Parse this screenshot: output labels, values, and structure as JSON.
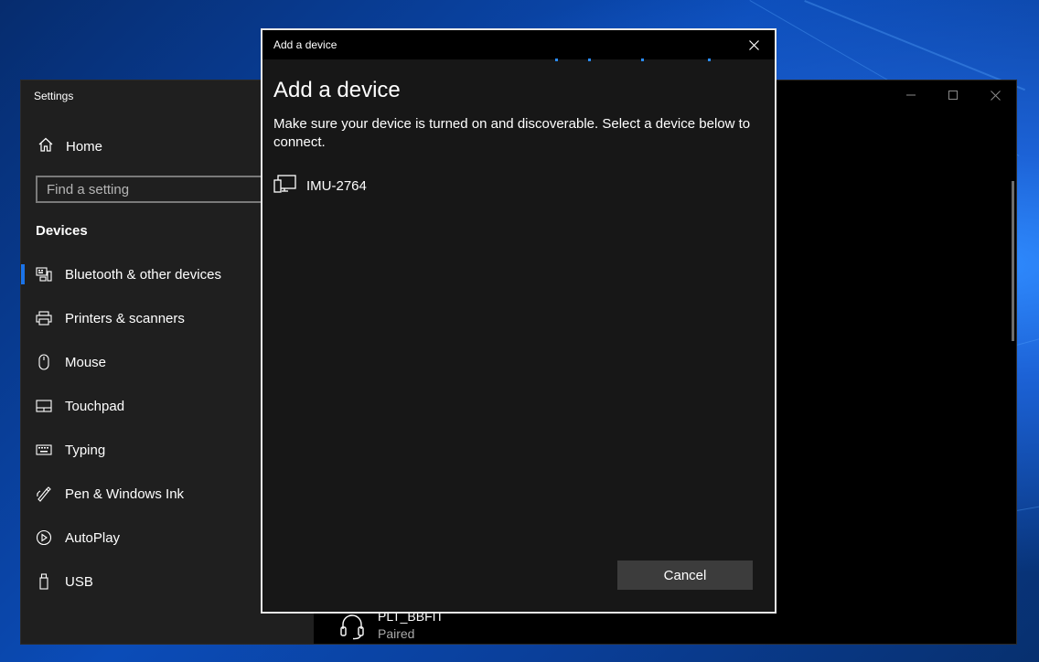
{
  "settings": {
    "title": "Settings",
    "home_label": "Home",
    "search_placeholder": "Find a setting",
    "section_title": "Devices",
    "nav_items": [
      {
        "label": "Bluetooth & other devices",
        "icon": "bluetooth-devices-icon",
        "selected": true
      },
      {
        "label": "Printers & scanners",
        "icon": "printer-icon",
        "selected": false
      },
      {
        "label": "Mouse",
        "icon": "mouse-icon",
        "selected": false
      },
      {
        "label": "Touchpad",
        "icon": "touchpad-icon",
        "selected": false
      },
      {
        "label": "Typing",
        "icon": "keyboard-icon",
        "selected": false
      },
      {
        "label": "Pen & Windows Ink",
        "icon": "pen-icon",
        "selected": false
      },
      {
        "label": "AutoPlay",
        "icon": "autoplay-icon",
        "selected": false
      },
      {
        "label": "USB",
        "icon": "usb-icon",
        "selected": false
      }
    ],
    "paired_device": {
      "name": "PLT_BBFIT",
      "status": "Paired",
      "icon": "headset-icon"
    }
  },
  "dialog": {
    "titlebar": "Add a device",
    "heading": "Add a device",
    "description": "Make sure your device is turned on and discoverable. Select a device below to connect.",
    "devices": [
      {
        "name": "IMU-2764",
        "icon": "generic-device-icon"
      }
    ],
    "cancel_label": "Cancel"
  },
  "colors": {
    "accent": "#1a73e8",
    "sidebar_bg": "#1f1f1f",
    "dialog_bg": "#171717",
    "button_bg": "#3c3c3c"
  }
}
